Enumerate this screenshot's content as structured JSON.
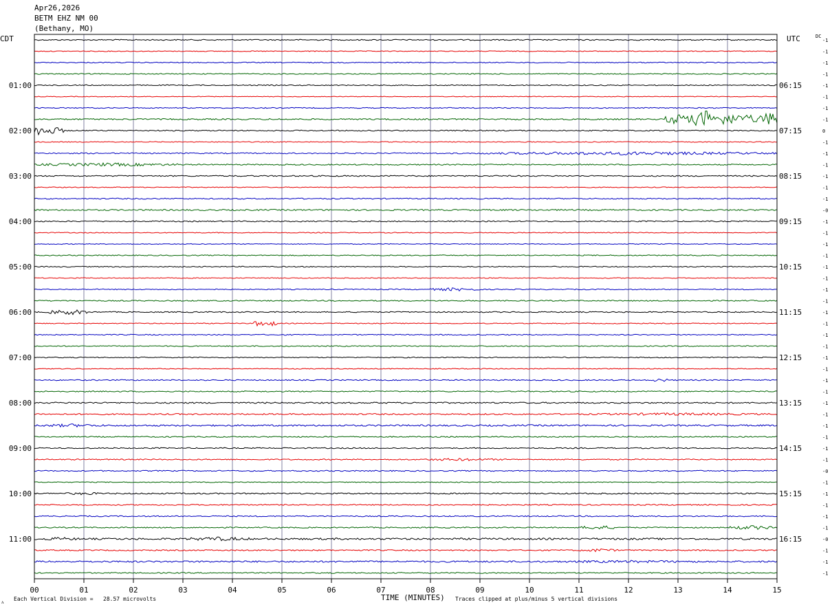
{
  "header": {
    "date": "Apr26,2026",
    "station": "BETM EHZ NM 00",
    "location": "(Bethany, MO)"
  },
  "left_zone_label": "CDT",
  "right_zone_label": "UTC",
  "dc_label": "DC",
  "footer": {
    "scale_note": "Each Vertical Division =   28.57 microvolts",
    "xlabel": "TIME (MINUTES)",
    "clip_note": "Traces clipped at plus/minus 5 vertical divisions",
    "corner_mark": "ᴧ"
  },
  "colors": {
    "trace_cycle": [
      "#000000",
      "#e60000",
      "#0000c0",
      "#006400"
    ],
    "grid": "#8080a0",
    "frame": "#000000"
  },
  "chart_data": {
    "type": "line",
    "title": "",
    "xlabel": "TIME (MINUTES)",
    "ylabel": "",
    "xlim": [
      0,
      15
    ],
    "x_ticks": [
      "00",
      "01",
      "02",
      "03",
      "04",
      "05",
      "06",
      "07",
      "08",
      "09",
      "10",
      "11",
      "12",
      "13",
      "14",
      "15"
    ],
    "trace_count": 48,
    "minutes_per_trace": 15,
    "left_hour_labels": [
      "01:00",
      "02:00",
      "03:00",
      "04:00",
      "05:00",
      "06:00",
      "07:00",
      "08:00",
      "09:00",
      "10:00",
      "11:00"
    ],
    "right_hour_labels": [
      "06:15",
      "07:15",
      "08:15",
      "09:15",
      "10:15",
      "11:15",
      "12:15",
      "13:15",
      "14:15",
      "15:15",
      "16:15"
    ],
    "dc_offsets": [
      "-1",
      "-1",
      "-1",
      "-1",
      "-1",
      "-1",
      "-1",
      "-1",
      "0",
      "-1",
      "-1",
      "-1",
      "-1",
      "-1",
      "-1",
      "-0",
      "-1",
      "-1",
      "-1",
      "-1",
      "-1",
      "-1",
      "-1",
      "-1",
      "-1",
      "-1",
      "-1",
      "-1",
      "-1",
      "-1",
      "-1",
      "-1",
      "-1",
      "-1",
      "-1",
      "-1",
      "-1",
      "-1",
      "-0",
      "-1",
      "-1",
      "-1",
      "-1",
      "-1",
      "-0",
      "-1",
      "-1",
      "-1"
    ],
    "series": [
      {
        "values": [
          0,
          0,
          0,
          0,
          0,
          0,
          0,
          0,
          0,
          0,
          0,
          0,
          0,
          0,
          0,
          0
        ],
        "noise": 0.8
      },
      {
        "values": [
          0,
          0,
          0,
          0,
          0,
          0,
          0,
          0,
          0,
          0,
          0,
          0,
          0,
          0,
          0,
          0
        ],
        "noise": 0.6
      },
      {
        "values": [
          0,
          0,
          0,
          0,
          0,
          0,
          0,
          0,
          0,
          0,
          0,
          0,
          0,
          0,
          0,
          0
        ],
        "noise": 0.7
      },
      {
        "values": [
          0,
          0,
          0,
          0,
          0,
          0,
          0,
          0,
          0,
          0,
          0,
          0,
          0,
          0,
          0,
          0
        ],
        "noise": 0.7
      },
      {
        "values": [
          0,
          0,
          0,
          0,
          0,
          0,
          0,
          0,
          0,
          0,
          0,
          0,
          0,
          0,
          0,
          0
        ],
        "noise": 0.7
      },
      {
        "values": [
          0,
          0,
          0,
          0,
          0,
          0,
          0,
          0,
          0,
          0,
          0,
          0,
          0,
          0,
          0,
          0
        ],
        "noise": 0.5
      },
      {
        "values": [
          0,
          0,
          0,
          0,
          0,
          0,
          0,
          0,
          0,
          0,
          0,
          0,
          0,
          0,
          0,
          0
        ],
        "noise": 0.7
      },
      {
        "values": [
          0,
          0,
          0,
          0,
          0,
          0,
          0,
          0,
          0,
          0,
          0,
          0,
          0,
          0,
          0,
          0
        ],
        "noise": 1.0,
        "events": [
          {
            "start": 12.7,
            "end": 15,
            "amp": 8
          },
          {
            "start": 13.3,
            "end": 13.8,
            "amp": 14
          },
          {
            "start": 12.9,
            "end": 13.1,
            "amp": 12
          },
          {
            "start": 14.7,
            "end": 15,
            "amp": 12
          }
        ]
      },
      {
        "values": [
          0,
          0,
          0,
          0,
          0,
          0,
          0,
          0,
          0,
          0,
          0,
          0,
          0,
          0,
          0,
          0
        ],
        "noise": 0.8,
        "events": [
          {
            "start": 0,
            "end": 0.6,
            "amp": 6
          },
          {
            "start": 0,
            "end": 0.15,
            "amp": 10
          }
        ]
      },
      {
        "values": [
          0,
          0,
          0,
          0,
          0,
          0,
          0,
          0,
          0,
          0,
          0,
          0,
          0,
          0,
          0,
          0
        ],
        "noise": 0.6
      },
      {
        "values": [
          0,
          0,
          0,
          0,
          0,
          0,
          0,
          0,
          0,
          0,
          0,
          0,
          0,
          0,
          0,
          0
        ],
        "noise": 0.8,
        "events": [
          {
            "start": 9,
            "end": 15,
            "amp": 2.5
          }
        ]
      },
      {
        "values": [
          0,
          0,
          0,
          0,
          0,
          0,
          0,
          0,
          0,
          0,
          0,
          0,
          0,
          0,
          0,
          0
        ],
        "noise": 0.8,
        "events": [
          {
            "start": 0,
            "end": 3,
            "amp": 2.5
          }
        ]
      },
      {
        "values": [
          0,
          0,
          0,
          0,
          0,
          0,
          0,
          0,
          0,
          0,
          0,
          0,
          0,
          0,
          0,
          0
        ],
        "noise": 0.9
      },
      {
        "values": [
          0,
          0,
          0,
          0,
          0,
          0,
          0,
          0,
          0,
          0,
          0,
          0,
          0,
          0,
          0,
          0
        ],
        "noise": 0.6
      },
      {
        "values": [
          0,
          0,
          0,
          0,
          0,
          0,
          0,
          0,
          0,
          0,
          0,
          0,
          0,
          0,
          0,
          0
        ],
        "noise": 0.8
      },
      {
        "values": [
          0,
          0,
          0,
          0,
          0,
          0,
          0,
          0,
          0,
          0,
          0,
          0,
          0,
          0,
          0,
          0
        ],
        "noise": 1.0
      },
      {
        "values": [
          0,
          0,
          0,
          0,
          0,
          0,
          0,
          0,
          0,
          0,
          0,
          0,
          0,
          0,
          0,
          0
        ],
        "noise": 0.8
      },
      {
        "values": [
          0,
          0,
          0,
          0,
          0,
          0,
          0,
          0,
          0,
          0,
          0,
          0,
          0,
          0,
          0,
          0
        ],
        "noise": 0.6
      },
      {
        "values": [
          0,
          0,
          0,
          0,
          0,
          0,
          0,
          0,
          0,
          0,
          0,
          0,
          0,
          0,
          0,
          0
        ],
        "noise": 0.6
      },
      {
        "values": [
          0,
          0,
          0,
          0,
          0,
          0,
          0,
          0,
          0,
          0,
          0,
          0,
          0,
          0,
          0,
          0
        ],
        "noise": 0.7
      },
      {
        "values": [
          0,
          0,
          0,
          0,
          0,
          0,
          0,
          0,
          0,
          0,
          0,
          0,
          0,
          0,
          0,
          0
        ],
        "noise": 0.7
      },
      {
        "values": [
          0,
          0,
          0,
          0,
          0,
          0,
          0,
          0,
          0,
          0,
          0,
          0,
          0,
          0,
          0,
          0
        ],
        "noise": 0.6
      },
      {
        "values": [
          0,
          0,
          0,
          0,
          0,
          0,
          0,
          0,
          0,
          0,
          0,
          0,
          0,
          0,
          0,
          0
        ],
        "noise": 0.7,
        "events": [
          {
            "start": 8,
            "end": 9,
            "amp": 2.5
          }
        ]
      },
      {
        "values": [
          0,
          0,
          0,
          0,
          0,
          0,
          0,
          0,
          0,
          0,
          0,
          0,
          0,
          0,
          0,
          0
        ],
        "noise": 0.8
      },
      {
        "values": [
          0,
          0,
          0,
          0,
          0,
          0,
          0,
          0,
          0,
          0,
          0,
          0,
          0,
          0,
          0,
          0
        ],
        "noise": 0.8,
        "events": [
          {
            "start": 0.3,
            "end": 1.1,
            "amp": 4
          }
        ]
      },
      {
        "values": [
          0,
          0,
          0,
          0,
          0,
          0,
          0,
          0,
          0,
          0,
          0,
          0,
          0,
          0,
          0,
          0
        ],
        "noise": 0.6,
        "events": [
          {
            "start": 4.4,
            "end": 4.9,
            "amp": 5
          }
        ]
      },
      {
        "values": [
          0,
          0,
          0,
          0,
          0,
          0,
          0,
          0,
          0,
          0,
          0,
          0,
          0,
          0,
          0,
          0
        ],
        "noise": 0.7
      },
      {
        "values": [
          0,
          0,
          0,
          0,
          0,
          0,
          0,
          0,
          0,
          0,
          0,
          0,
          0,
          0,
          0,
          0
        ],
        "noise": 0.7
      },
      {
        "values": [
          0,
          0,
          0,
          0,
          0,
          0,
          0,
          0,
          0,
          0,
          0,
          0,
          0,
          0,
          0,
          0
        ],
        "noise": 0.7
      },
      {
        "values": [
          0,
          0,
          0,
          0,
          0,
          0,
          0,
          0,
          0,
          0,
          0,
          0,
          0,
          0,
          0,
          0
        ],
        "noise": 0.6
      },
      {
        "values": [
          0,
          0,
          0,
          0,
          0,
          0,
          0,
          0,
          0,
          0,
          0,
          0,
          0,
          0,
          0,
          0
        ],
        "noise": 0.8,
        "events": [
          {
            "start": 12.5,
            "end": 12.8,
            "amp": 3
          }
        ]
      },
      {
        "values": [
          0,
          0,
          0,
          0,
          0,
          0,
          0,
          0,
          0,
          0,
          0,
          0,
          0,
          0,
          0,
          0
        ],
        "noise": 0.8
      },
      {
        "values": [
          0,
          0,
          0,
          0,
          0,
          0,
          0,
          0,
          0,
          0,
          0,
          0,
          0,
          0,
          0,
          0
        ],
        "noise": 1.0
      },
      {
        "values": [
          0,
          0,
          0,
          0,
          0,
          0,
          0,
          0,
          0,
          0,
          0,
          0,
          0,
          0,
          0,
          0
        ],
        "noise": 1.0,
        "events": [
          {
            "start": 11,
            "end": 15,
            "amp": 2
          }
        ]
      },
      {
        "values": [
          0,
          0,
          0,
          0,
          0,
          0,
          0,
          0,
          0,
          0,
          0,
          0,
          0,
          0,
          0,
          0
        ],
        "noise": 1.2,
        "events": [
          {
            "start": 0,
            "end": 1.5,
            "amp": 2.5
          }
        ]
      },
      {
        "values": [
          0,
          0,
          0,
          0,
          0,
          0,
          0,
          0,
          0,
          0,
          0,
          0,
          0,
          0,
          0,
          0
        ],
        "noise": 0.8
      },
      {
        "values": [
          0,
          0,
          0,
          0,
          0,
          0,
          0,
          0,
          0,
          0,
          0,
          0,
          0,
          0,
          0,
          0
        ],
        "noise": 0.8
      },
      {
        "values": [
          0,
          0,
          0,
          0,
          0,
          0,
          0,
          0,
          0,
          0,
          0,
          0,
          0,
          0,
          0,
          0
        ],
        "noise": 0.8,
        "events": [
          {
            "start": 7.8,
            "end": 9.5,
            "amp": 2
          }
        ]
      },
      {
        "values": [
          0,
          0,
          0,
          0,
          0,
          0,
          0,
          0,
          0,
          0,
          0,
          0,
          0,
          0,
          0,
          0
        ],
        "noise": 0.8
      },
      {
        "values": [
          0,
          0,
          0,
          0,
          0,
          0,
          0,
          0,
          0,
          0,
          0,
          0,
          0,
          0,
          0,
          0
        ],
        "noise": 0.6
      },
      {
        "values": [
          0,
          0,
          0,
          0,
          0,
          0,
          0,
          0,
          0,
          0,
          0,
          0,
          0,
          0,
          0,
          0
        ],
        "noise": 1.0,
        "events": [
          {
            "start": 0.5,
            "end": 1.5,
            "amp": 2
          }
        ]
      },
      {
        "values": [
          0,
          0,
          0,
          0,
          0,
          0,
          0,
          0,
          0,
          0,
          0,
          0,
          0,
          0,
          0,
          0
        ],
        "noise": 0.8
      },
      {
        "values": [
          0,
          0,
          0,
          0,
          0,
          0,
          0,
          0,
          0,
          0,
          0,
          0,
          0,
          0,
          0,
          0
        ],
        "noise": 0.8
      },
      {
        "values": [
          0,
          0,
          0,
          0,
          0,
          0,
          0,
          0,
          0,
          0,
          0,
          0,
          0,
          0,
          0,
          0
        ],
        "noise": 0.8,
        "events": [
          {
            "start": 11,
            "end": 11.8,
            "amp": 3
          },
          {
            "start": 14,
            "end": 15,
            "amp": 3
          }
        ]
      },
      {
        "values": [
          0,
          0,
          0,
          0,
          0,
          0,
          0,
          0,
          0,
          0,
          0,
          0,
          0,
          0,
          0,
          0
        ],
        "noise": 1.3,
        "events": [
          {
            "start": 0,
            "end": 1,
            "amp": 2.5
          },
          {
            "start": 3,
            "end": 4.4,
            "amp": 3
          }
        ]
      },
      {
        "values": [
          0,
          0,
          0,
          0,
          0,
          0,
          0,
          0,
          0,
          0,
          0,
          0,
          0,
          0,
          0,
          0
        ],
        "noise": 0.9,
        "events": [
          {
            "start": 11,
            "end": 11.8,
            "amp": 2.5
          }
        ]
      },
      {
        "values": [
          0,
          0,
          0,
          0,
          0,
          0,
          0,
          0,
          0,
          0,
          0,
          0,
          0,
          0,
          0,
          0
        ],
        "noise": 1.2,
        "events": [
          {
            "start": 10,
            "end": 14,
            "amp": 2
          }
        ]
      },
      {
        "values": [
          0,
          0,
          0,
          0,
          0,
          0,
          0,
          0,
          0,
          0,
          0,
          0,
          0,
          0,
          0,
          0
        ],
        "noise": 0.8
      }
    ]
  }
}
